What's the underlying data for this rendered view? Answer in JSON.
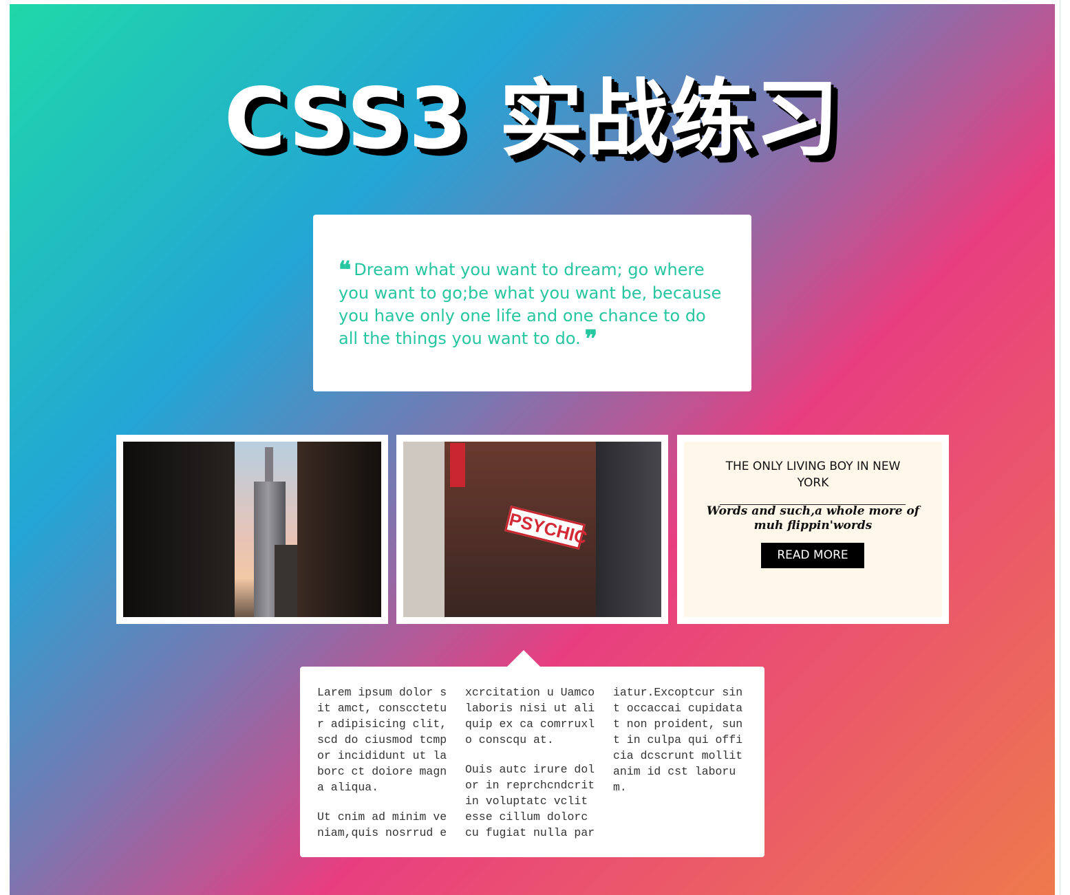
{
  "page": {
    "title": "CSS3 实战练习"
  },
  "quote": {
    "text": "Dream what you want to dream; go where you want to go;be what you want be, because you have only one life and one chance to do all the things you want to do.",
    "open_mark": "❝",
    "close_mark": "❞",
    "color": "#26c6a0"
  },
  "gallery": {
    "photo1_icon": "empire-state-building-photo",
    "photo2_icon": "psychic-sign-street-photo",
    "photo2_sign_text": "PSYCHIC"
  },
  "feature_card": {
    "title": "THE ONLY LIVING BOY IN NEW YORK",
    "subtitle": "Words and such,a whole more of muh flippin'words",
    "button_label": "READ MORE",
    "background": "#fef7ea"
  },
  "lorem": {
    "column1": [
      "Larem ipsum dolor sit amct, conscctetur adipisicing clit, scd do ciusmod tcmpor incididunt ut laborc ct doiore magna aliqua.",
      "Ut cnim ad minim veniam,quis nosrrud e"
    ],
    "column2": [
      "xcrcitation u Uamco laboris nisi ut aliquip ex ca comrruxlo conscqu at.",
      "Ouis autc irure dolor in reprchcndcrit in voluptatc vclit esse cillum dolorc cu fugiat nulla par"
    ],
    "column3": [
      "iatur.Excoptcur sint occaccai cupidatat non proident, sunt in culpa qui officia dcscrunt mollit anim id cst laborum."
    ]
  },
  "colors": {
    "gradient_start": "#1fd8a8",
    "gradient_mid": "#e83e80",
    "gradient_end": "#ee7a4c"
  }
}
